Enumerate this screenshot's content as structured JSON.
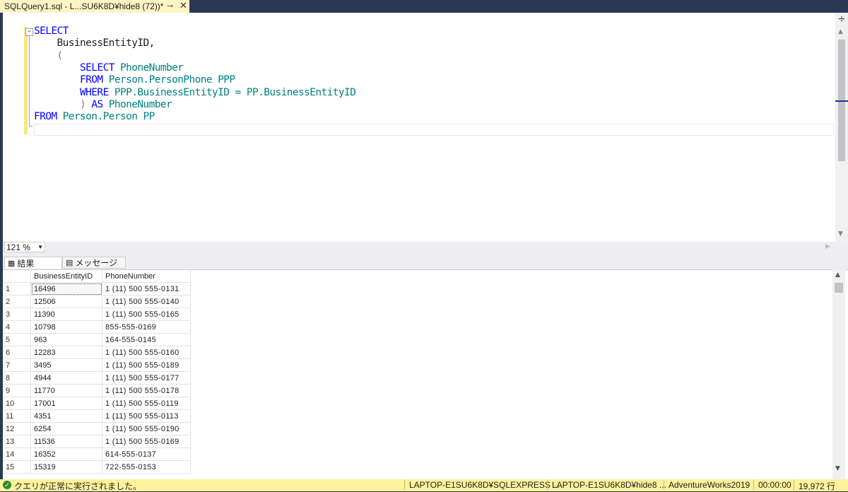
{
  "tab": {
    "title": "SQLQuery1.sql - L...SU6K8D¥hide8 (72))*",
    "pin_icon": "pin-icon",
    "close_icon": "close-icon"
  },
  "editor": {
    "lines": [
      [
        {
          "t": "SELECT",
          "c": "kw"
        }
      ],
      [
        {
          "t": "    BusinessEntityID,",
          "c": "ph"
        }
      ],
      [
        {
          "t": "    (",
          "c": "gray"
        }
      ],
      [
        {
          "t": "        ",
          "c": "ph"
        },
        {
          "t": "SELECT",
          "c": "kw"
        },
        {
          "t": " PhoneNumber",
          "c": "obj"
        }
      ],
      [
        {
          "t": "        ",
          "c": "ph"
        },
        {
          "t": "FROM",
          "c": "kw"
        },
        {
          "t": " Person.PersonPhone PPP",
          "c": "obj"
        }
      ],
      [
        {
          "t": "        ",
          "c": "ph"
        },
        {
          "t": "WHERE",
          "c": "kw"
        },
        {
          "t": " PPP.BusinessEntityID = PP.BusinessEntityID",
          "c": "obj"
        }
      ],
      [
        {
          "t": "        ) ",
          "c": "gray"
        },
        {
          "t": "AS",
          "c": "kw"
        },
        {
          "t": " PhoneNumber",
          "c": "obj"
        }
      ],
      [
        {
          "t": "FROM",
          "c": "kw"
        },
        {
          "t": " Person.Person PP",
          "c": "obj"
        }
      ]
    ]
  },
  "zoom": {
    "value": "121 %"
  },
  "results": {
    "tabs": [
      {
        "label": "結果",
        "icon": "grid-icon"
      },
      {
        "label": "メッセージ",
        "icon": "message-icon"
      }
    ],
    "columns": [
      "",
      "BusinessEntityID",
      "PhoneNumber"
    ],
    "rows": [
      [
        "1",
        "16496",
        "1 (11) 500 555-0131"
      ],
      [
        "2",
        "12506",
        "1 (11) 500 555-0140"
      ],
      [
        "3",
        "11390",
        "1 (11) 500 555-0165"
      ],
      [
        "4",
        "10798",
        "855-555-0169"
      ],
      [
        "5",
        "963",
        "164-555-0145"
      ],
      [
        "6",
        "12283",
        "1 (11) 500 555-0160"
      ],
      [
        "7",
        "3495",
        "1 (11) 500 555-0189"
      ],
      [
        "8",
        "4944",
        "1 (11) 500 555-0177"
      ],
      [
        "9",
        "11770",
        "1 (11) 500 555-0178"
      ],
      [
        "10",
        "17001",
        "1 (11) 500 555-0119"
      ],
      [
        "11",
        "4351",
        "1 (11) 500 555-0113"
      ],
      [
        "12",
        "6254",
        "1 (11) 500 555-0190"
      ],
      [
        "13",
        "11536",
        "1 (11) 500 555-0169"
      ],
      [
        "14",
        "16352",
        "614-555-0137"
      ],
      [
        "15",
        "15319",
        "722-555-0153"
      ]
    ]
  },
  "status": {
    "message": "クエリが正常に実行されました。",
    "server": "LAPTOP-E1SU6K8D¥SQLEXPRESS ...",
    "login": "LAPTOP-E1SU6K8D¥hide8 ...",
    "database": "AdventureWorks2019",
    "elapsed": "00:00:00",
    "rowcount": "19,972 行"
  },
  "colors": {
    "keyword": "#0000ff",
    "identifier": "#008080",
    "tab_active_bg": "#fff5c4",
    "statusbar_bg": "#fff29d",
    "window_bg": "#293955"
  }
}
